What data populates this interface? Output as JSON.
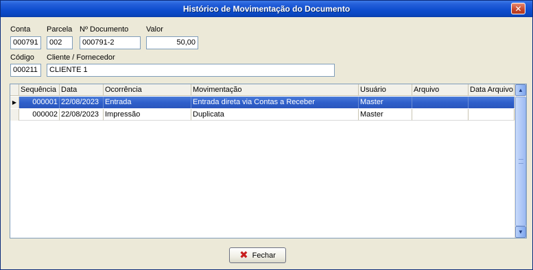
{
  "window": {
    "title": "Histórico de Movimentação do Documento",
    "close_glyph": "✕"
  },
  "fields": {
    "conta": {
      "label": "Conta",
      "value": "000791"
    },
    "parcela": {
      "label": "Parcela",
      "value": "002"
    },
    "documento": {
      "label": "Nº Documento",
      "value": "000791-2"
    },
    "valor": {
      "label": "Valor",
      "value": "50,00"
    },
    "codigo": {
      "label": "Código",
      "value": "000211"
    },
    "cliente": {
      "label": "Cliente / Fornecedor",
      "value": "CLIENTE 1"
    }
  },
  "grid": {
    "columns": [
      "Sequência",
      "Data",
      "Ocorrência",
      "Movimentação",
      "Usuário",
      "Arquivo",
      "Data Arquivo"
    ],
    "rows": [
      {
        "sequencia": "000001",
        "data": "22/08/2023",
        "ocorrencia": "Entrada",
        "movimentacao": "Entrada direta via Contas a Receber",
        "usuario": "Master",
        "arquivo": "",
        "data_arquivo": "",
        "selected": true
      },
      {
        "sequencia": "000002",
        "data": "22/08/2023",
        "ocorrencia": "Impressão",
        "movimentacao": "Duplicata",
        "usuario": "Master",
        "arquivo": "",
        "data_arquivo": "",
        "selected": false
      }
    ],
    "row_indicator": "▶"
  },
  "buttons": {
    "fechar": "Fechar"
  },
  "icons": {
    "close": "close-icon",
    "fechar": "x-icon",
    "scroll_up": "arrow-up-icon",
    "scroll_down": "arrow-down-icon"
  },
  "colors": {
    "titlebar": "#0A46C0",
    "selection": "#2F5FCB",
    "window_bg": "#ECE9D8",
    "fechar_icon": "#C81E1E"
  }
}
